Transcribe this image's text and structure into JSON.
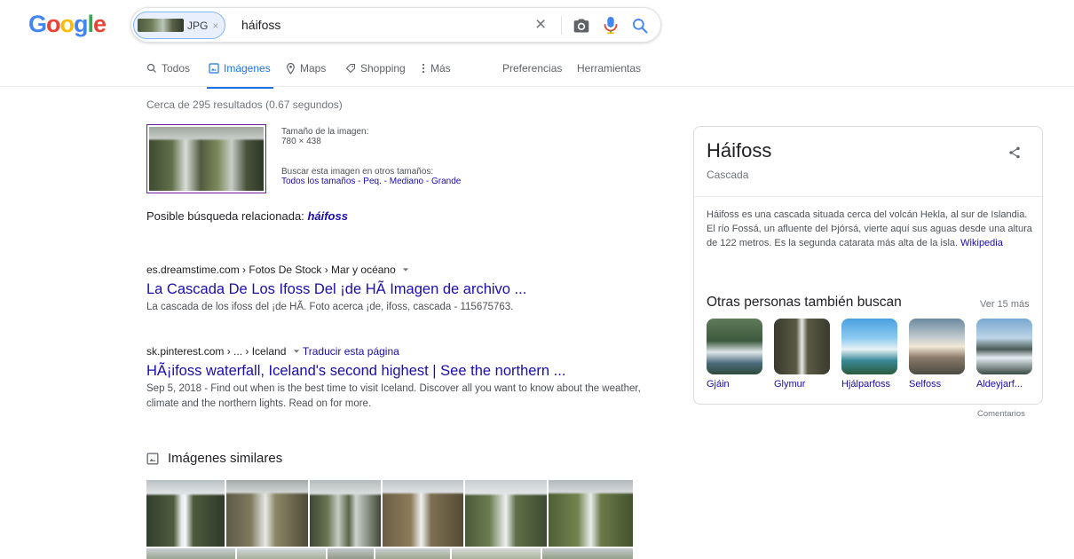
{
  "header": {
    "logo": [
      "G",
      "o",
      "o",
      "g",
      "l",
      "e"
    ],
    "logo_colors": [
      "#4285F4",
      "#EA4335",
      "#FBBC05",
      "#4285F4",
      "#34A853",
      "#EA4335"
    ],
    "chip_label": "JPG",
    "chip_close": "×",
    "query": "háifoss",
    "clear": "×"
  },
  "tabs": {
    "todos": "Todos",
    "imagenes": "Imágenes",
    "maps": "Maps",
    "shopping": "Shopping",
    "mas": "Más",
    "preferencias": "Preferencias",
    "herramientas": "Herramientas"
  },
  "results": {
    "stats": "Cerca de 295 resultados (0.67 segundos)",
    "size_label": "Tamaño de la imagen:",
    "size_value": "780 × 438",
    "other_sizes_label": "Buscar esta imagen en otros tamaños:",
    "sizes": [
      "Todos los tamaños",
      "Peq.",
      "Mediano",
      "Grande"
    ],
    "sizes_sep": " - ",
    "related_label": "Posible búsqueda relacionada:",
    "related_query": "háifoss",
    "items": [
      {
        "crumb": "es.dreamstime.com › Fotos De Stock › Mar y océano",
        "crumb_extra": "",
        "title": "La Cascada De Los Ifoss Del ¡de HÃ Imagen de archivo ...",
        "snippet": "La cascada de los ifoss del ¡de HÃ. Foto acerca ¡de, ifoss, cascada - 115675763."
      },
      {
        "crumb": "sk.pinterest.com › ... › Iceland",
        "crumb_extra": "Traducir esta página",
        "title": "HÃ¡ifoss waterfall, Iceland's second highest | See the northern ...",
        "snippet": "Sep 5, 2018 - Find out when is the best time to visit Iceland. Discover all you want to know about the weather, climate and the northern lights. Read on for more."
      }
    ],
    "similar_heading": "Imágenes similares"
  },
  "knowledge_panel": {
    "title": "Háifoss",
    "subtitle": "Cascada",
    "description": "Háifoss es una cascada situada cerca del volcán Hekla, al sur de Islandia. El río Fossá, un afluente del Þjórsá, vierte aquí sus aguas desde una altura de 122 metros. Es la segunda catarata más alta de la isla.",
    "source": "Wikipedia",
    "also_search": "Otras personas también buscan",
    "see_more": "Ver 15 más",
    "related": [
      "Gjáin",
      "Glymur",
      "Hjálparfoss",
      "Selfoss",
      "Aldeyjarf..."
    ],
    "feedback": "Comentarios"
  },
  "colors": {
    "link": "#1a0dab",
    "accent": "#1a73e8",
    "muted": "#70757a"
  }
}
